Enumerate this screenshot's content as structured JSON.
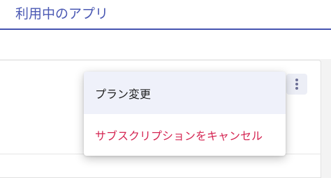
{
  "header": {
    "title": "利用中のアプリ"
  },
  "card": {
    "more_icon": "vertical-ellipsis-icon"
  },
  "menu": {
    "items": [
      {
        "label": "プラン変更",
        "color": "#222222"
      },
      {
        "label": "サブスクリプションをキャンセル",
        "color": "#d52653"
      }
    ]
  },
  "colors": {
    "accent": "#4653b0",
    "danger": "#d52653",
    "highlight": "#eff1fa"
  }
}
